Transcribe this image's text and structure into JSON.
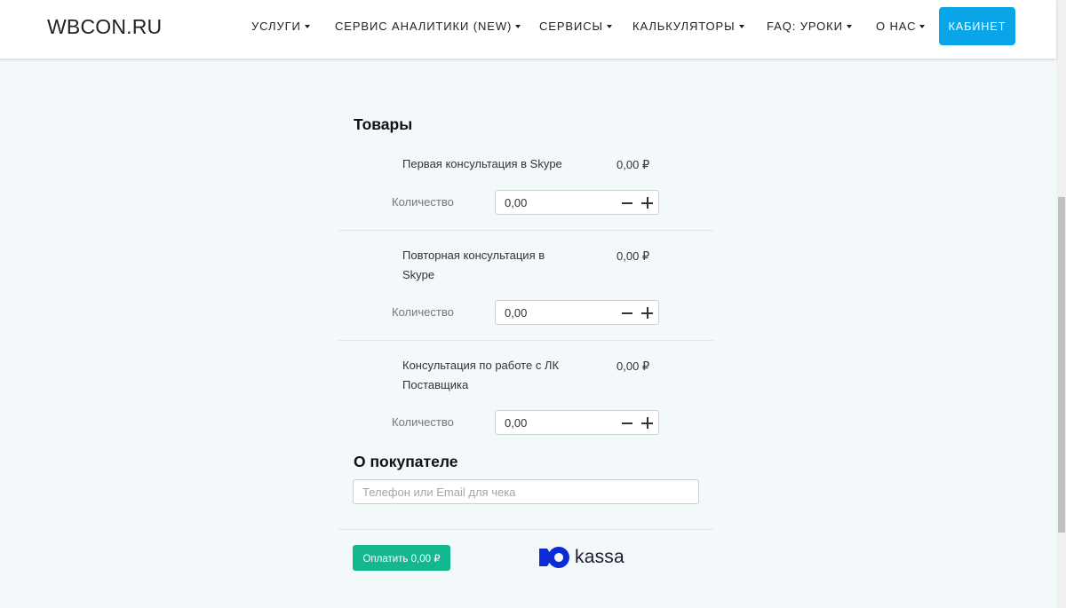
{
  "header": {
    "logo": "WBCON.RU",
    "nav": [
      {
        "label": "УСЛУГИ",
        "has_dropdown": true
      },
      {
        "label": "СЕРВИС АНАЛИТИКИ (NEW)",
        "has_dropdown": true
      },
      {
        "label": "СЕРВИСЫ",
        "has_dropdown": true
      },
      {
        "label": "КАЛЬКУЛЯТОРЫ",
        "has_dropdown": true
      },
      {
        "label": "FAQ: УРОКИ",
        "has_dropdown": true
      },
      {
        "label": "О НАС",
        "has_dropdown": true
      }
    ],
    "cabinet_label": "КАБИНЕТ"
  },
  "products_section": {
    "title": "Товары",
    "items": [
      {
        "name": "Первая консультация в Skype",
        "price": "0,00 ₽",
        "qty_label": "Количество",
        "qty_value": "0,00"
      },
      {
        "name": "Повторная консультация в Skype",
        "price": "0,00 ₽",
        "qty_label": "Количество",
        "qty_value": "0,00"
      },
      {
        "name": "Консультация по работе с ЛК Поставщика",
        "price": "0,00 ₽",
        "qty_label": "Количество",
        "qty_value": "0,00"
      }
    ]
  },
  "buyer_section": {
    "title": "О покупателе",
    "contact_placeholder": "Телефон или Email для чека",
    "contact_value": ""
  },
  "payment": {
    "pay_label": "Оплатить 0,00 ₽",
    "provider_logo_text": "kassa"
  },
  "colors": {
    "accent_blue": "#0aa5e8",
    "pay_green": "#14b88f",
    "background": "#f3f8fb"
  }
}
